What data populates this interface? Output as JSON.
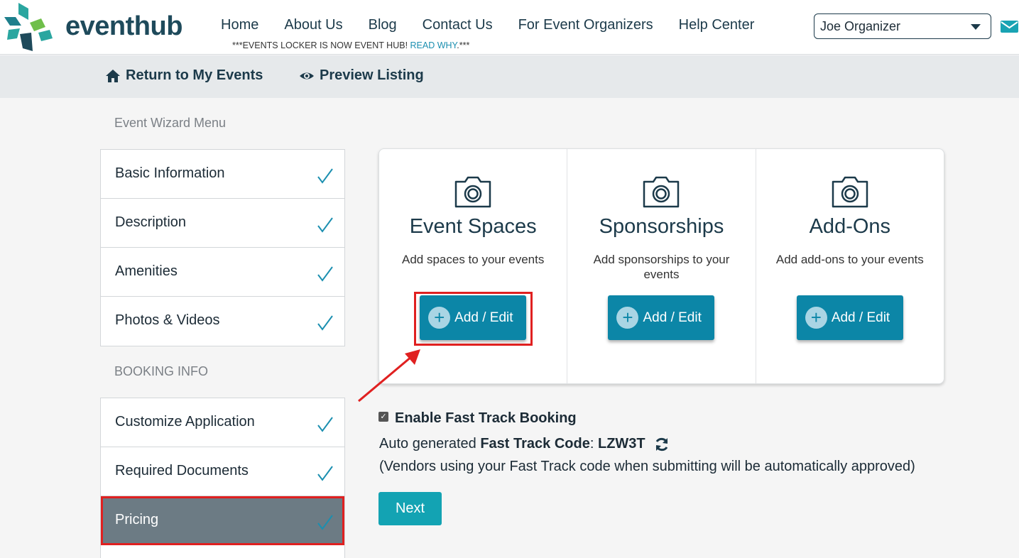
{
  "header": {
    "logo_text": "eventhub",
    "nav": [
      "Home",
      "About Us",
      "Blog",
      "Contact Us",
      "For Event Organizers",
      "Help Center"
    ],
    "announcement_prefix": "***EVENTS LOCKER IS NOW EVENT HUB! ",
    "announcement_link": "READ WHY",
    "announcement_suffix": ".***",
    "user_select_value": "Joe Organizer"
  },
  "subbar": {
    "return_label": "Return to My Events",
    "preview_label": "Preview Listing"
  },
  "sidebar": {
    "wizard_heading": "Event Wizard Menu",
    "wizard_items": [
      {
        "label": "Basic Information",
        "done": true
      },
      {
        "label": "Description",
        "done": true
      },
      {
        "label": "Amenities",
        "done": true
      },
      {
        "label": "Photos & Videos",
        "done": true
      }
    ],
    "booking_heading": "BOOKING INFO",
    "booking_items": [
      {
        "label": "Customize Application",
        "done": true
      },
      {
        "label": "Required Documents",
        "done": true
      },
      {
        "label": "Pricing",
        "done": true,
        "active": true
      }
    ]
  },
  "cards": [
    {
      "title": "Event Spaces",
      "desc": "Add spaces to your events",
      "button": "Add / Edit"
    },
    {
      "title": "Sponsorships",
      "desc": "Add sponsorships to your events",
      "button": "Add / Edit"
    },
    {
      "title": "Add-Ons",
      "desc": "Add add-ons to your events",
      "button": "Add / Edit"
    }
  ],
  "fast_track": {
    "enabled": true,
    "label": "Enable Fast Track Booking",
    "code_prefix": "Auto generated ",
    "code_label": "Fast Track Code",
    "code_sep": ": ",
    "code_value": "LZW3T",
    "note": "(Vendors using your Fast Track code when submitting will be automatically approved)"
  },
  "next_label": "Next",
  "colors": {
    "primary": "#0c86a7",
    "next": "#13a3b3",
    "active_item": "#6c7b84",
    "highlight": "#e02020",
    "check": "#1b8fb0"
  }
}
